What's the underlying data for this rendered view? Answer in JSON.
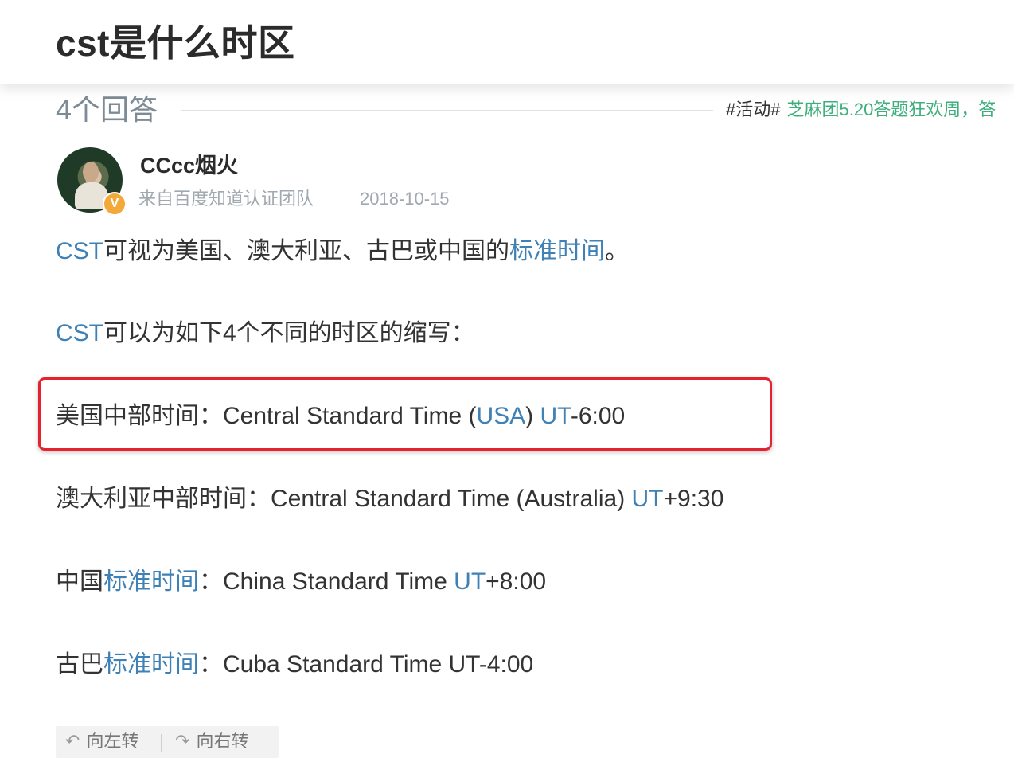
{
  "header": {
    "title": "cst是什么时区"
  },
  "answers": {
    "count_label": "4个回答"
  },
  "activity": {
    "tag": "#活动#",
    "text": "芝麻团5.20答题狂欢周，答"
  },
  "author": {
    "name": "CCcc烟火",
    "badge": "V",
    "source": "来自百度知道认证团队",
    "date": "2018-10-15"
  },
  "body": {
    "p1": {
      "link1": "CST",
      "text1": "可视为美国、澳大利亚、古巴或中国的",
      "link2": "标准时间",
      "text2": "。"
    },
    "p2": {
      "link1": "CST",
      "text1": "可以为如下4个不同的时区的缩写："
    },
    "p3": {
      "text1": "美国中部时间：Central Standard Time (",
      "link1": "USA",
      "text2": ") ",
      "link2": "UT",
      "text3": "-6:00"
    },
    "p4": {
      "text1": "澳大利亚中部时间：Central Standard Time (Australia) ",
      "link1": "UT",
      "text2": "+9:30"
    },
    "p5": {
      "text1": "中国",
      "link1": "标准时间",
      "text2": "：China Standard Time ",
      "link2": "UT",
      "text3": "+8:00"
    },
    "p6": {
      "text1": "古巴",
      "link1": "标准时间",
      "text2": "：Cuba Standard Time UT-4:00"
    }
  },
  "toolbar": {
    "rotate_left": "向左转",
    "rotate_right": "向右转"
  },
  "colors": {
    "link": "#3f80b5",
    "activity": "#3eaf7c",
    "highlight": "#e52230",
    "badge": "#f3a93a"
  }
}
